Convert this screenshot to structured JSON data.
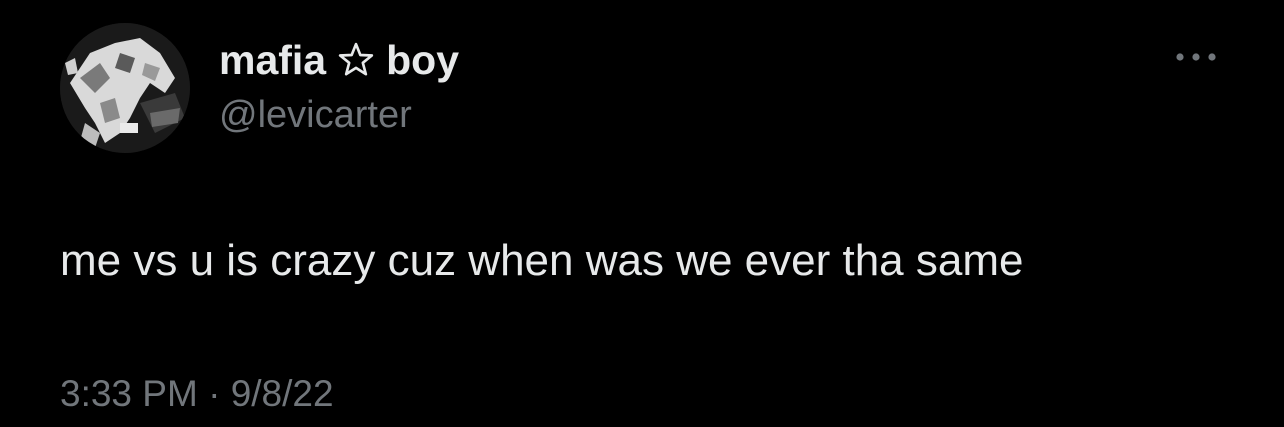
{
  "tweet": {
    "author": {
      "name_part1": "mafia",
      "name_part2": "boy",
      "handle": "@levicarter",
      "star_icon": "star-outline-icon",
      "avatar_icon": "avatar-image"
    },
    "more_icon": "more-horizontal-icon",
    "text": "me vs u is crazy cuz when was we ever tha same",
    "time": "3:33 PM",
    "separator": "·",
    "date": "9/8/22"
  },
  "colors": {
    "background": "#000000",
    "primary_text": "#e7e9ea",
    "secondary_text": "#71767b"
  }
}
